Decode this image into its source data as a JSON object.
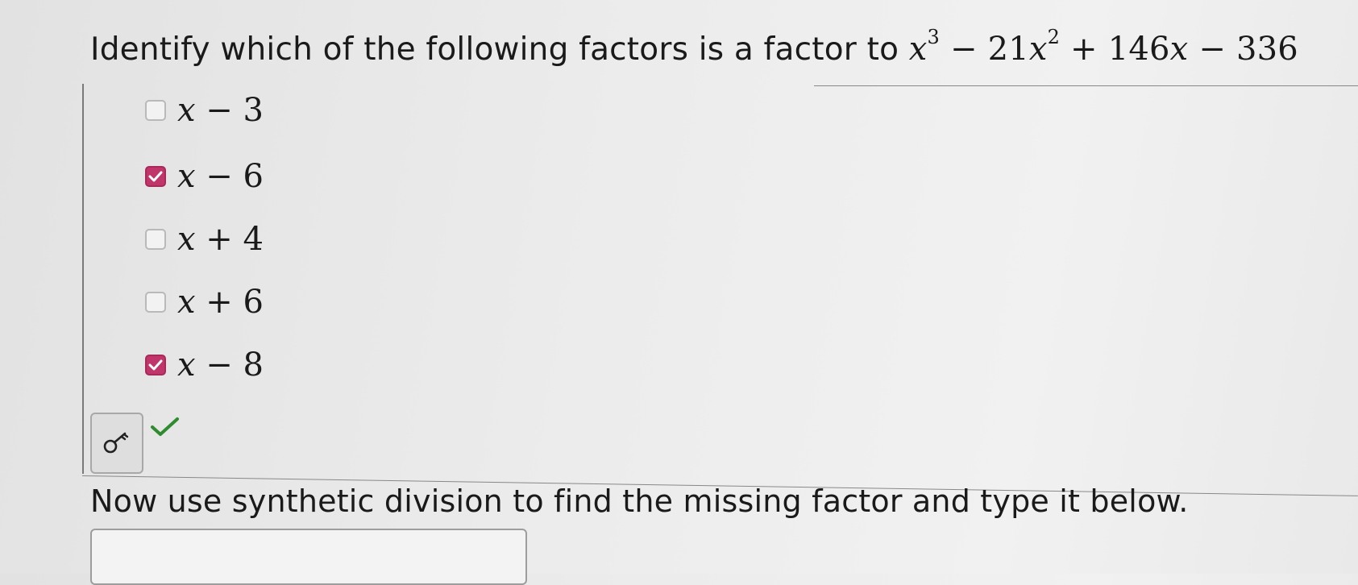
{
  "question": {
    "prompt": "Identify which of the following factors is a factor to",
    "polynomial": {
      "t1_var": "x",
      "t1_exp": "3",
      "t2_sign": " − ",
      "t2_coef": "21",
      "t2_var": "x",
      "t2_exp": "2",
      "t3_sign": " + ",
      "t3_coef": "146",
      "t3_var": "x",
      "t4_sign": " − ",
      "t4_const": "336"
    }
  },
  "options": [
    {
      "var": "x",
      "op": " − ",
      "num": "3",
      "checked": false
    },
    {
      "var": "x",
      "op": " − ",
      "num": "6",
      "checked": true
    },
    {
      "var": "x",
      "op": " + ",
      "num": "4",
      "checked": false
    },
    {
      "var": "x",
      "op": " + ",
      "num": "6",
      "checked": false
    },
    {
      "var": "x",
      "op": " − ",
      "num": "8",
      "checked": true
    }
  ],
  "status": {
    "answer_correct": true,
    "check_color": "#2e8b2e"
  },
  "accent_color": "#c0366a",
  "icons": {
    "key_button": "key-icon",
    "correct": "checkmark-icon",
    "checkbox_checked": "checkbox-check-icon"
  },
  "instruction": "Now use synthetic division to find the missing factor and type it below.",
  "answer_input": {
    "value": ""
  }
}
